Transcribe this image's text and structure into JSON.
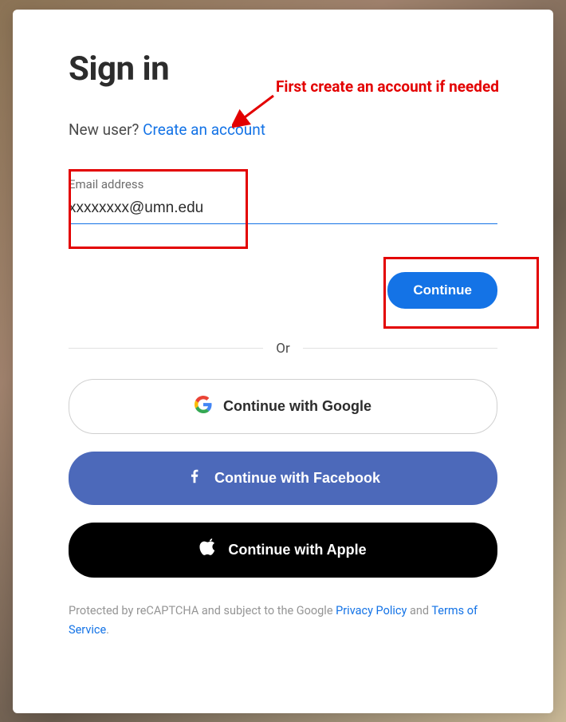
{
  "title": "Sign in",
  "newUser": {
    "prompt": "New user? ",
    "link": "Create an account"
  },
  "emailField": {
    "label": "Email address",
    "value": "xxxxxxxx@umn.edu"
  },
  "continueLabel": "Continue",
  "divider": "Or",
  "social": {
    "google": "Continue with Google",
    "facebook": "Continue with Facebook",
    "apple": "Continue with Apple"
  },
  "footer": {
    "prefix": "Protected by reCAPTCHA and subject to the Google ",
    "privacy": "Privacy Policy",
    "and": " and ",
    "terms": "Terms of Service",
    "suffix": "."
  },
  "annotation": {
    "text": "First create an account if needed"
  }
}
